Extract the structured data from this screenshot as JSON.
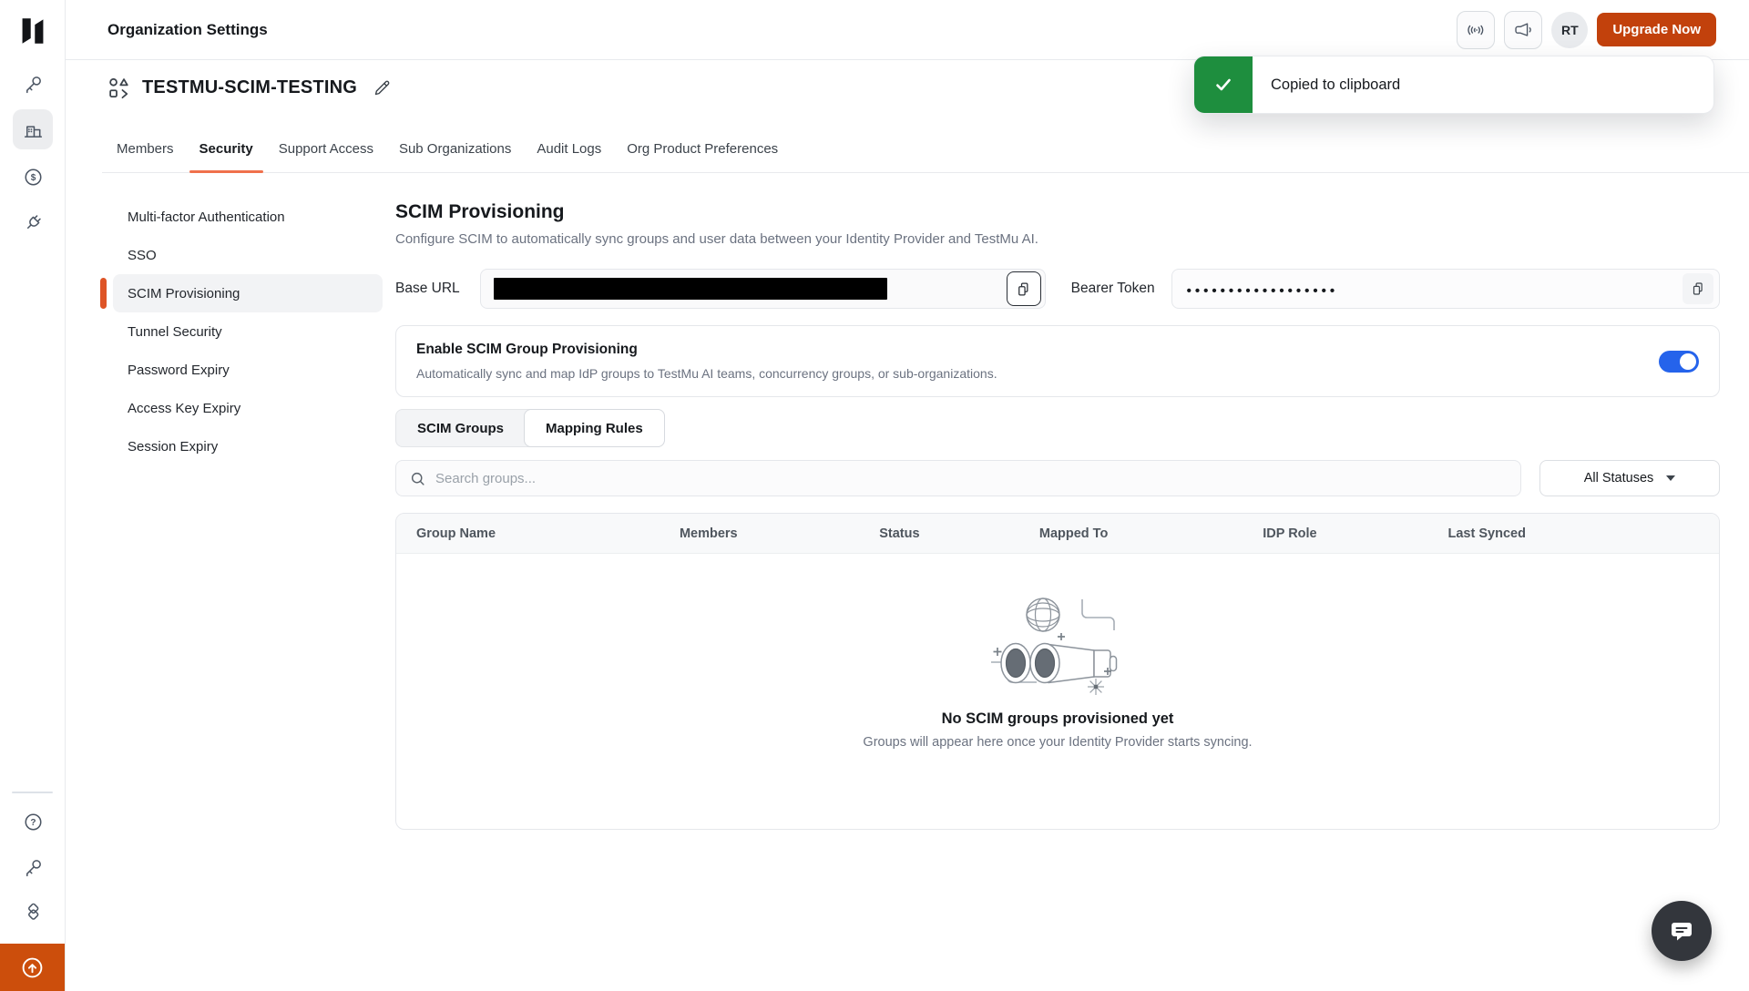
{
  "colors": {
    "accent_orange": "#C2410C",
    "rail_orange": "#CC4E0C",
    "tab_underline": "#F0714C",
    "subnav_accent": "#DE5426",
    "toggle_blue": "#2563EB",
    "toast_green": "#1E8E3E"
  },
  "topbar": {
    "title": "Organization Settings",
    "avatar_initials": "RT",
    "upgrade_label": "Upgrade Now"
  },
  "toast": {
    "message": "Copied to clipboard"
  },
  "org_header": {
    "name": "TESTMU-SCIM-TESTING"
  },
  "tabs": {
    "items": [
      {
        "label": "Members",
        "active": false
      },
      {
        "label": "Security",
        "active": true
      },
      {
        "label": "Support Access",
        "active": false
      },
      {
        "label": "Sub Organizations",
        "active": false
      },
      {
        "label": "Audit Logs",
        "active": false
      },
      {
        "label": "Org Product Preferences",
        "active": false
      }
    ]
  },
  "security_nav": {
    "items": [
      {
        "label": "Multi-factor Authentication",
        "active": false
      },
      {
        "label": "SSO",
        "active": false
      },
      {
        "label": "SCIM Provisioning",
        "active": true
      },
      {
        "label": "Tunnel Security",
        "active": false
      },
      {
        "label": "Password Expiry",
        "active": false
      },
      {
        "label": "Access Key Expiry",
        "active": false
      },
      {
        "label": "Session Expiry",
        "active": false
      }
    ]
  },
  "scim": {
    "title": "SCIM Provisioning",
    "description": "Configure SCIM to automatically sync groups and user data between your Identity Provider and TestMu AI.",
    "base_url": {
      "label": "Base URL"
    },
    "bearer_token": {
      "label": "Bearer Token",
      "masked_value": "••••••••••••••••••"
    },
    "enable_group_provisioning": {
      "title": "Enable SCIM Group Provisioning",
      "description": "Automatically sync and map IdP groups to TestMu AI teams, concurrency groups, or sub-organizations.",
      "enabled": true
    },
    "view_tabs": {
      "items": [
        {
          "label": "SCIM Groups",
          "active": true
        },
        {
          "label": "Mapping Rules",
          "active": false
        }
      ]
    },
    "search": {
      "placeholder": "Search groups...",
      "value": ""
    },
    "status_filter": {
      "selected": "All Statuses"
    },
    "table": {
      "columns": [
        "Group Name",
        "Members",
        "Status",
        "Mapped To",
        "IDP Role",
        "Last Synced"
      ],
      "rows": []
    },
    "empty_state": {
      "title": "No SCIM groups provisioned yet",
      "subtitle": "Groups will appear here once your Identity Provider starts syncing."
    }
  },
  "icons": {
    "rail": [
      "key",
      "organization-building",
      "billing-dollar",
      "integrations-plug"
    ],
    "rail_bottom": [
      "help-question",
      "access-key",
      "stack",
      "upgrade-arrow"
    ],
    "topbar": [
      "pulse-waves",
      "megaphone"
    ]
  }
}
